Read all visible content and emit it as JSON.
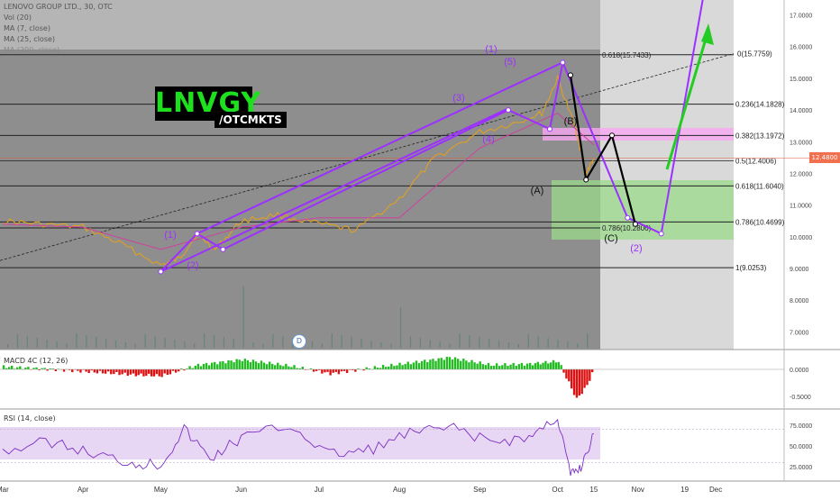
{
  "header": {
    "symbol_line": "LENOVO GROUP LTD., 30, OTC",
    "indicators": [
      "Vol (20)",
      "MA (7, close)",
      "MA (25, close)",
      "MA (200, close)"
    ]
  },
  "logo": {
    "ticker": "LNVGY",
    "exchange": "/OTCMKTS"
  },
  "price_tag": "12.4800",
  "event_marker": "D",
  "colors": {
    "wave": "#9b30ff",
    "corrective": "#000000",
    "projection": "#22cc22",
    "price_line": "#e0a020",
    "ma_line": "#d040a0",
    "fib_line": "#222222",
    "price_tag_bg": "#f07050",
    "logo_bg": "#000000",
    "logo_text": "#1ee01e"
  },
  "chart_data": [
    {
      "type": "line",
      "title": "LENOVO GROUP LTD., 30, OTC",
      "x_tick_labels": [
        "Mar",
        "Apr",
        "May",
        "Jun",
        "Jul",
        "Aug",
        "Sep",
        "Oct",
        "15",
        "Nov",
        "19",
        "Dec"
      ],
      "y_tick_labels": [
        "17.0000",
        "16.0000",
        "15.0000",
        "14.0000",
        "13.0000",
        "12.0000",
        "11.0000",
        "10.0000",
        "9.0000",
        "8.0000",
        "7.0000"
      ],
      "ylim": [
        6.5,
        17.3
      ],
      "log_scale": false,
      "grid": false,
      "series": [
        {
          "name": "close",
          "x": [
            "2018-03-01",
            "2018-03-15",
            "2018-04-01",
            "2018-04-15",
            "2018-05-01",
            "2018-05-08",
            "2018-05-15",
            "2018-05-22",
            "2018-06-01",
            "2018-06-15",
            "2018-07-01",
            "2018-07-15",
            "2018-08-01",
            "2018-08-15",
            "2018-09-01",
            "2018-09-15",
            "2018-09-25",
            "2018-10-01",
            "2018-10-08",
            "2018-10-12",
            "2018-10-15"
          ],
          "y": [
            10.5,
            10.4,
            10.3,
            9.8,
            9.1,
            9.3,
            10.1,
            9.6,
            10.5,
            10.7,
            10.4,
            10.2,
            11.2,
            12.5,
            13.3,
            13.6,
            13.9,
            15.0,
            13.4,
            12.0,
            12.48
          ]
        },
        {
          "name": "MA (25, close)",
          "x": [
            "2018-03-01",
            "2018-04-01",
            "2018-05-01",
            "2018-06-01",
            "2018-07-01",
            "2018-08-01",
            "2018-09-01",
            "2018-10-01",
            "2018-10-15"
          ],
          "y": [
            10.4,
            10.3,
            9.6,
            10.3,
            10.6,
            10.6,
            12.8,
            13.9,
            12.9
          ]
        }
      ],
      "fibonacci_levels": [
        {
          "ratio": "0.618",
          "value": "15.7433",
          "label": "0.618(15.7433)"
        },
        {
          "ratio": "0",
          "value": "15.7759",
          "label": "0(15.7759)"
        },
        {
          "ratio": "0.236",
          "value": "14.1828",
          "label": "0.236(14.1828)"
        },
        {
          "ratio": "0.382",
          "value": "13.1972",
          "label": "0.382(13.1972)"
        },
        {
          "ratio": "0.5",
          "value": "12.4006",
          "label": "0.5(12.4006)"
        },
        {
          "ratio": "0.618",
          "value": "11.6040",
          "label": "0.618(11.6040)"
        },
        {
          "ratio": "0.786",
          "value": "10.4699",
          "label": "0.786(10.4699)"
        },
        {
          "ratio": "0.786",
          "value": "10.2806",
          "label": "0.786(10.2806)"
        },
        {
          "ratio": "1",
          "value": "9.0253",
          "label": "1(9.0253)"
        }
      ],
      "wave_labels": [
        "(1)",
        "(2)",
        "(3)",
        "(4)",
        "(5)",
        "(1)",
        "(2)",
        "(A)",
        "(B)",
        "(C)",
        "(2)"
      ],
      "elliott_primary": {
        "x": [
          "2018-05-01",
          "2018-05-15",
          "2018-05-25",
          "2018-09-12",
          "2018-09-28",
          "2018-10-03",
          "2018-10-28",
          "2018-11-10"
        ],
        "y": [
          8.9,
          10.1,
          9.6,
          14.0,
          13.4,
          15.5,
          10.6,
          10.1
        ]
      },
      "abc_correction": {
        "x": [
          "2018-10-06",
          "2018-10-12",
          "2018-10-22",
          "2018-10-31"
        ],
        "y": [
          15.1,
          11.8,
          13.2,
          10.4
        ]
      }
    },
    {
      "type": "area",
      "title": "MACD 4C (12, 26)",
      "y_tick_labels": [
        "0.0000",
        "-0.5000"
      ],
      "ylim": [
        -0.7,
        0.3
      ],
      "grid": false,
      "series": [
        {
          "name": "MACD 4C (12, 26)",
          "x": [
            "2018-03-01",
            "2018-03-20",
            "2018-04-05",
            "2018-04-20",
            "2018-05-01",
            "2018-05-15",
            "2018-06-01",
            "2018-06-20",
            "2018-07-05",
            "2018-07-20",
            "2018-08-05",
            "2018-08-20",
            "2018-09-05",
            "2018-09-20",
            "2018-10-01",
            "2018-10-08",
            "2018-10-12",
            "2018-10-15"
          ],
          "y": [
            0.05,
            0.0,
            -0.05,
            -0.1,
            -0.12,
            0.08,
            0.18,
            0.06,
            -0.08,
            0.02,
            0.12,
            0.22,
            0.08,
            0.1,
            0.15,
            -0.55,
            -0.3,
            0.05
          ]
        }
      ]
    },
    {
      "type": "line",
      "title": "RSI (14, close)",
      "y_tick_labels": [
        "75.0000",
        "50.0000",
        "25.0000"
      ],
      "ylim": [
        10,
        90
      ],
      "grid": false,
      "band": [
        30,
        70
      ],
      "series": [
        {
          "name": "RSI (14, close)",
          "x": [
            "2018-03-01",
            "2018-03-20",
            "2018-04-05",
            "2018-04-20",
            "2018-05-01",
            "2018-05-10",
            "2018-05-20",
            "2018-06-01",
            "2018-06-20",
            "2018-07-05",
            "2018-07-20",
            "2018-08-05",
            "2018-08-20",
            "2018-09-05",
            "2018-09-20",
            "2018-10-01",
            "2018-10-06",
            "2018-10-10",
            "2018-10-15"
          ],
          "y": [
            45,
            55,
            40,
            30,
            28,
            70,
            35,
            60,
            75,
            40,
            45,
            65,
            72,
            55,
            60,
            85,
            15,
            25,
            65
          ]
        }
      ]
    }
  ]
}
